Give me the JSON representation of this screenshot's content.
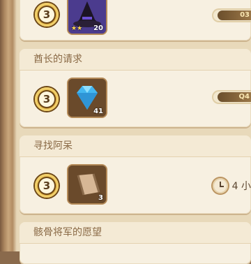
{
  "quests": [
    {
      "title": "",
      "level": "3",
      "item_icon": "wizard-hat-icon",
      "item_count": "20",
      "item_stars": "★★",
      "reward_text": "03"
    },
    {
      "title": "酋长的请求",
      "level": "3",
      "item_icon": "blue-gem-icon",
      "item_count": "41",
      "reward_text": "Q4"
    },
    {
      "title": "寻找阿呆",
      "level": "3",
      "item_icon": "scroll-icon",
      "item_count": "3",
      "timer_text": "4 小"
    },
    {
      "title": "骸骨将军的愿望"
    }
  ],
  "colors": {
    "card_bg": "#f7f0e1",
    "header_text": "#8a6a46",
    "badge_gold": "#d9a53a",
    "gem_blue": "#44b7f0"
  }
}
